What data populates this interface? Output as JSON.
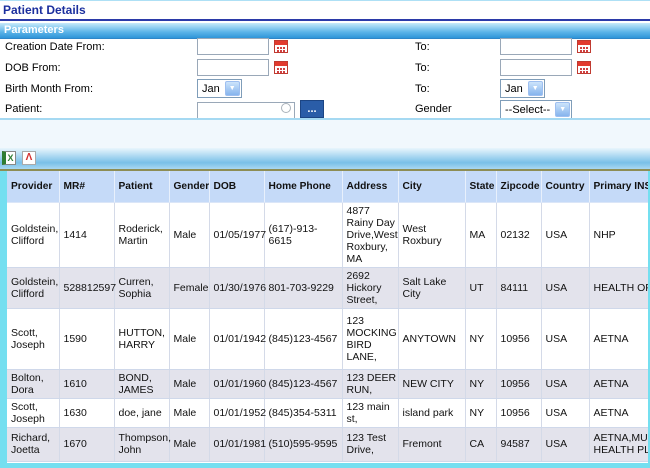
{
  "page": {
    "title": "Patient Details"
  },
  "parameters": {
    "header": "Parameters",
    "fields": {
      "creation_date": {
        "label": "Creation Date From:",
        "value": "",
        "to_label": "To:",
        "to_value": ""
      },
      "dob": {
        "label": "DOB From:",
        "value": "",
        "to_label": "To:",
        "to_value": ""
      },
      "birth_month": {
        "label": "Birth Month From:",
        "value": "Jan",
        "to_label": "To:",
        "to_value": "Jan"
      },
      "patient": {
        "label": "Patient:",
        "value": "",
        "browse_button": "..."
      },
      "gender": {
        "label": "Gender",
        "value": "--Select--"
      }
    }
  },
  "toolbar": {
    "excel_icon": "X",
    "pdf_icon": "Λ"
  },
  "table": {
    "columns": [
      "Provider",
      "MR#",
      "Patient",
      "Gender",
      "DOB",
      "Home Phone",
      "Address",
      "City",
      "State",
      "Zipcode",
      "Country",
      "Primary INS."
    ],
    "rows": [
      [
        "Goldstein, Clifford",
        "1414",
        "Roderick, Martin",
        "Male",
        "01/05/1977",
        "(617)-913-6615",
        "4877 Rainy Day Drive,West Roxbury, MA",
        "West Roxbury",
        "MA",
        "02132",
        "USA",
        "NHP"
      ],
      [
        "Goldstein, Clifford",
        "528812597",
        "Curren, Sophia",
        "Female",
        "01/30/1976",
        "801-703-9229",
        "2692 Hickory Street,",
        "Salt Lake City",
        "UT",
        "84111",
        "USA",
        "HEALTH OPTION"
      ],
      [
        "Scott, Joseph",
        "1590",
        "HUTTON, HARRY",
        "Male",
        "01/01/1942",
        "(845)123-4567",
        "123 MOCKING BIRD LANE,",
        "ANYTOWN",
        "NY",
        "10956",
        "USA",
        "AETNA"
      ],
      [
        "Bolton, Dora",
        "1610",
        "BOND, JAMES",
        "Male",
        "01/01/1960",
        "(845)123-4567",
        "123 DEER RUN,",
        "NEW CITY",
        "NY",
        "10956",
        "USA",
        "AETNA"
      ],
      [
        "Scott, Joseph",
        "1630",
        "doe, jane",
        "Male",
        "01/01/1952",
        "(845)354-5311",
        "123 main st,",
        "island park",
        "NY",
        "10956",
        "USA",
        "AETNA"
      ],
      [
        "Richard, Joetta",
        "1670",
        "Thompson, John",
        "Male",
        "01/01/1981",
        "(510)595-9595",
        "123 Test Drive,",
        "Fremont",
        "CA",
        "94587",
        "USA",
        "AETNA,MULTIPLAN HEALTH PLAN"
      ]
    ]
  },
  "colors": {
    "title_blue": "#1b2f9e",
    "params_bar_top": "#c7eafa",
    "params_bar_bottom": "#2f95d8",
    "header_bg": "#c5daf8",
    "row_alt": "#e3e3ec",
    "frame_aqua": "#74dff0",
    "toolbar_rule_olive": "#8d8d55",
    "button_blue": "#2a5da8",
    "calendar_red": "#e23a2e"
  }
}
